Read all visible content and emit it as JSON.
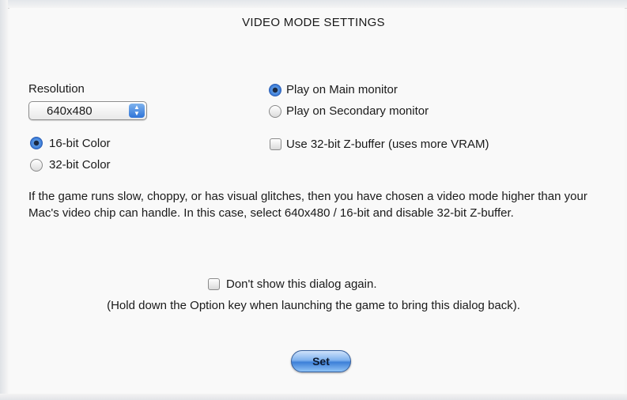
{
  "dialog": {
    "title": "VIDEO MODE SETTINGS"
  },
  "resolution": {
    "label": "Resolution",
    "selected": "640x480",
    "stepper_icon": "up-down-arrows"
  },
  "color_depth": {
    "options": [
      {
        "label": "16-bit Color",
        "selected": true
      },
      {
        "label": "32-bit Color",
        "selected": false
      }
    ]
  },
  "monitor": {
    "options": [
      {
        "label": "Play on Main monitor",
        "selected": true
      },
      {
        "label": "Play on Secondary monitor",
        "selected": false
      }
    ]
  },
  "zbuffer": {
    "label": "Use 32-bit Z-buffer (uses more VRAM)",
    "checked": false
  },
  "help_text": "If the game runs slow, choppy, or has visual glitches, then you have chosen a video mode higher than your Mac's video chip can handle.   In this case, select 640x480 / 16-bit and disable 32-bit Z-buffer.",
  "dont_show": {
    "label": "Don't show this dialog again.",
    "checked": false,
    "note": "(Hold down the Option key when launching the game to bring this dialog back)."
  },
  "buttons": {
    "set_label": "Set"
  },
  "colors": {
    "accent": "#2e6fd0",
    "background": "#f9f9f9",
    "text": "#1a1a1a"
  }
}
